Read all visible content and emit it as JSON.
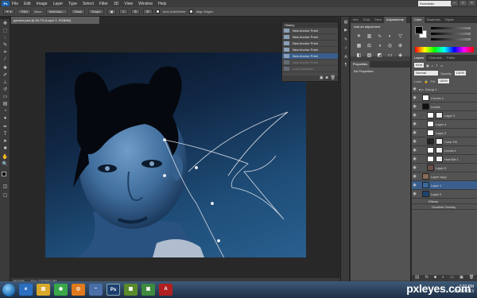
{
  "menubar": {
    "logo": "Ps",
    "items": [
      "File",
      "Edit",
      "Image",
      "Layer",
      "Type",
      "Select",
      "Filter",
      "3D",
      "View",
      "Window",
      "Help"
    ],
    "workspace": "Essentials"
  },
  "optionsbar": {
    "path_mode": "Path",
    "make_label": "Make:",
    "selection_btn": "Selection...",
    "mask_btn": "Mask",
    "shape_btn": "Shape",
    "auto_label": "Auto Add/Delete",
    "align_label": "Align Edges"
  },
  "document": {
    "tab_title": "gamora.psd @ 66.7% (Layer 1, RGB/8#)",
    "zoom": "66.67%",
    "doc_info": "Doc: 7.91M/67.4M"
  },
  "history": {
    "title": "History",
    "items": [
      {
        "label": "New Anchor Point",
        "state": "normal"
      },
      {
        "label": "New Anchor Point",
        "state": "normal"
      },
      {
        "label": "New Anchor Point",
        "state": "normal"
      },
      {
        "label": "New Anchor Point",
        "state": "normal"
      },
      {
        "label": "New Anchor Point",
        "state": "selected"
      },
      {
        "label": "New Anchor Point",
        "state": "dim"
      },
      {
        "label": "Load Selection",
        "state": "dim"
      }
    ]
  },
  "midpanels": {
    "tabs": [
      "Info",
      "Char",
      "Para",
      "Adjustments"
    ],
    "adj_title": "Add an adjustment",
    "props_tabs": [
      "Properties"
    ],
    "props_text": "No Properties"
  },
  "color_panel": {
    "tabs": [
      "Color",
      "Swatches",
      "Styles"
    ]
  },
  "layers_panel": {
    "tabs": [
      "Layers",
      "Channels",
      "Paths"
    ],
    "kind": "Kind",
    "blend": "Normal",
    "opacity_label": "Opacity:",
    "opacity": "100%",
    "fill_label": "Fill:",
    "fill": "100%",
    "lock_label": "Lock:",
    "layers": [
      {
        "name": "Group 1",
        "sel": false
      },
      {
        "name": "Curves 1",
        "sel": false
      },
      {
        "name": "Levels",
        "sel": false
      },
      {
        "name": "Layer 3",
        "sel": false
      },
      {
        "name": "Layer 4",
        "sel": false
      },
      {
        "name": "Layer 2",
        "sel": false
      },
      {
        "name": "Color Fill",
        "sel": false
      },
      {
        "name": "Levels 1",
        "sel": false
      },
      {
        "name": "Hue/Sat 1",
        "sel": false
      },
      {
        "name": "Layer 5",
        "sel": false
      },
      {
        "name": "Layer copy",
        "sel": false
      },
      {
        "name": "Layer 1",
        "sel": true
      },
      {
        "name": "Layer 0",
        "sel": false
      },
      {
        "name": "Effects",
        "sel": false
      },
      {
        "name": "Gradient Overlay",
        "sel": false
      }
    ]
  },
  "taskbar": {
    "time": "2:23 PM",
    "date": "30/06/2013",
    "apps": [
      {
        "label": "e",
        "color": "#2a6fc0"
      },
      {
        "label": "▤",
        "color": "#d7a82a"
      },
      {
        "label": "◉",
        "color": "#3aa84a"
      },
      {
        "label": "◎",
        "color": "#e07a1c"
      },
      {
        "label": "~",
        "color": "#4a6ea8"
      },
      {
        "label": "Ps",
        "color": "#1c3f6e"
      },
      {
        "label": "▦",
        "color": "#5a8a2a"
      },
      {
        "label": "▣",
        "color": "#3e8a3e"
      },
      {
        "label": "A",
        "color": "#b02020"
      }
    ]
  },
  "watermark": "pxleyes.com"
}
